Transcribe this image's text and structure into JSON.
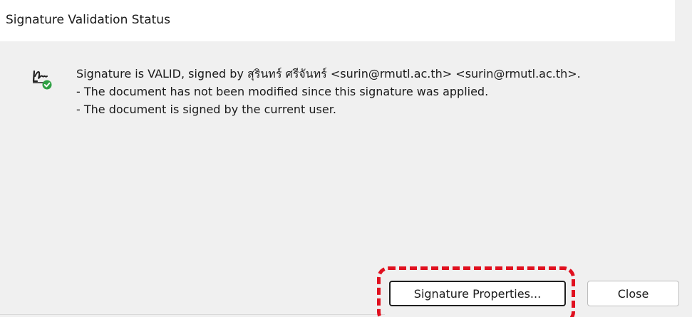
{
  "dialog": {
    "title": "Signature Validation Status"
  },
  "message": {
    "line1": "Signature is VALID, signed by สุรินทร์ ศรีจันทร์ <surin@rmutl.ac.th> <surin@rmutl.ac.th>.",
    "line2": "- The document has not been modified since this signature was applied.",
    "line3": "- The document is signed by the current user."
  },
  "buttons": {
    "signature_properties": "Signature Properties...",
    "close": "Close"
  },
  "icons": {
    "status_icon": "signature-valid-icon",
    "status_color": "#2ea043"
  },
  "colors": {
    "highlight": "#e0101f"
  }
}
